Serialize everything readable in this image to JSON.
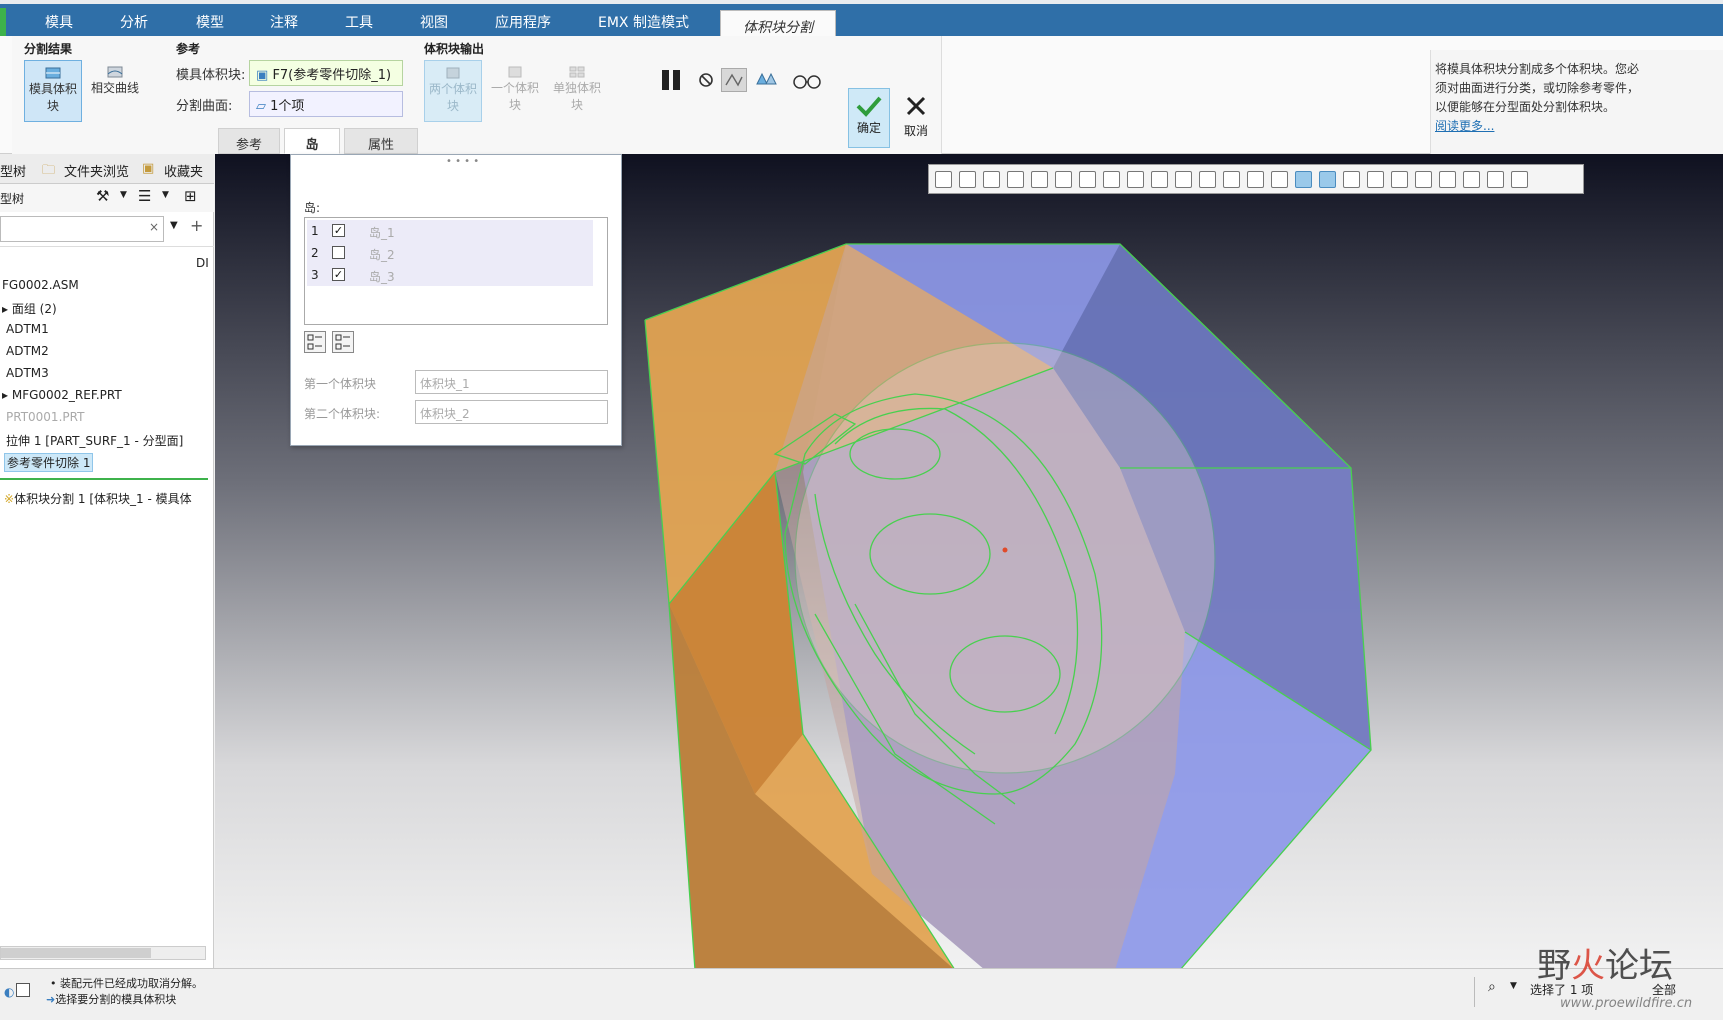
{
  "menu": {
    "tabs": [
      "模具",
      "分析",
      "模型",
      "注释",
      "工具",
      "视图",
      "应用程序",
      "EMX 制造模式"
    ],
    "active_tab": "体积块分割"
  },
  "ribbon": {
    "split_result": {
      "title": "分割结果",
      "mold_volume_btn": "模具体积块",
      "intersect_curve_btn": "相交曲线"
    },
    "reference": {
      "title": "参考",
      "mold_volume_label": "模具体积块:",
      "mold_volume_value": "F7(参考零件切除_1)",
      "split_surface_label": "分割曲面:",
      "split_surface_value": "1个项"
    },
    "volume_output": {
      "title": "体积块输出",
      "two_volumes": "两个体积块",
      "one_volume": "一个体积块",
      "single_volume": "单独体积块"
    },
    "subtabs": [
      "参考",
      "岛",
      "属性"
    ],
    "active_subtab": "岛",
    "confirm_label": "确定",
    "cancel_label": "取消"
  },
  "help": {
    "text_line1": "将模具体积块分割成多个体积块。您必",
    "text_line2": "须对曲面进行分类，或切除参考零件，",
    "text_line3": "以便能够在分型面处分割体积块。",
    "link": "阅读更多..."
  },
  "left_panel": {
    "tabs": [
      "型树",
      "文件夹浏览",
      "收藏夹"
    ],
    "toolbar_label": "型树",
    "column_header": "DI",
    "tree": [
      {
        "label": "FG0002.ASM",
        "state": "normal"
      },
      {
        "label": "▸ 面组 (2)",
        "state": "normal"
      },
      {
        "label": "ADTM1",
        "state": "normal"
      },
      {
        "label": "ADTM2",
        "state": "normal"
      },
      {
        "label": "ADTM3",
        "state": "normal"
      },
      {
        "label": "▸ MFG0002_REF.PRT",
        "state": "normal"
      },
      {
        "label": "PRT0001.PRT",
        "state": "grey"
      },
      {
        "label": "拉伸 1 [PART_SURF_1 - 分型面]",
        "state": "normal"
      },
      {
        "label": "参考零件切除 1",
        "state": "selected"
      }
    ],
    "insert_item": "体积块分割 1 [体积块_1 - 模具体"
  },
  "island_panel": {
    "label": "岛:",
    "rows": [
      {
        "num": "1",
        "checked": true,
        "name": "岛_1"
      },
      {
        "num": "2",
        "checked": false,
        "name": "岛_2"
      },
      {
        "num": "3",
        "checked": true,
        "name": "岛_3"
      }
    ],
    "first_volume_label": "第一个体积块",
    "first_volume_value": "体积块_1",
    "second_volume_label": "第二个体积块:",
    "second_volume_value": "体积块_2"
  },
  "status": {
    "msg1": "装配元件已经成功取消分解。",
    "msg2": "选择要分割的模具体积块",
    "selection": "选择了 1 项",
    "filter": "全部"
  },
  "watermark": {
    "text_dark1": "野",
    "text_red": "火",
    "text_dark2": "论坛",
    "url": "www.proewildfire.cn"
  },
  "colors": {
    "menu_blue": "#2f6fa8",
    "accent_green": "#3db24b",
    "block_orange": "#e0a050",
    "block_blue": "#8d98e8"
  }
}
